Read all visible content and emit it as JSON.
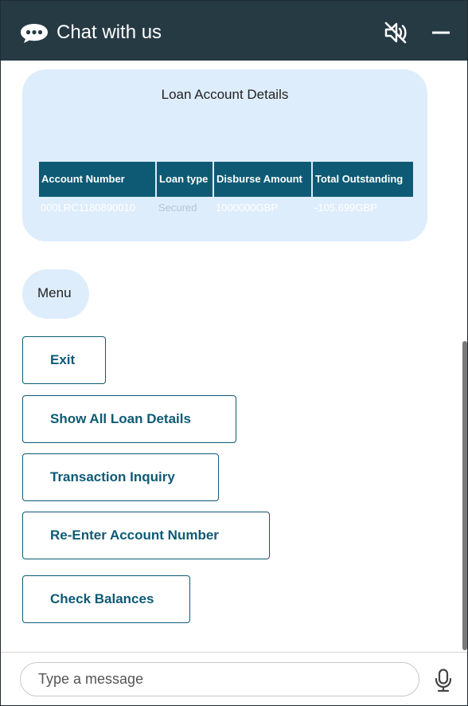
{
  "header": {
    "title": "Chat with us",
    "icons": {
      "chat": "chat-bubble-icon",
      "mute": "speaker-muted-icon",
      "minimize": "minimize-icon"
    },
    "background": "#263a44"
  },
  "loan_bubble": {
    "title": "Loan Account Details",
    "table": {
      "headers": [
        "Account Number",
        "Loan type",
        "Disburse Amount",
        "Total Outstanding"
      ],
      "rows": [
        [
          "000LRC1180890010",
          "Secured",
          "1000000GBP",
          "-105.699GBP"
        ]
      ]
    }
  },
  "menu_bubble": {
    "label": "Menu"
  },
  "options": [
    {
      "label": "Exit"
    },
    {
      "label": "Show All Loan Details"
    },
    {
      "label": "Transaction Inquiry"
    },
    {
      "label": "Re-Enter Account Number"
    },
    {
      "label": "Check Balances"
    }
  ],
  "composer": {
    "placeholder": "Type a message",
    "mic_icon": "microphone-icon"
  },
  "colors": {
    "accent": "#0e5a74",
    "bubble": "#deedfc"
  }
}
